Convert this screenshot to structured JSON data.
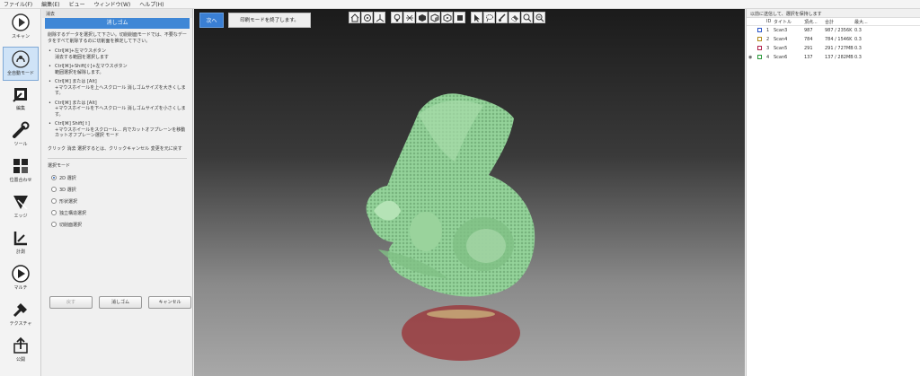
{
  "menu": [
    "ファイル(F)",
    "編集(E)",
    "ビュー",
    "ウィンドウ(W)",
    "ヘルプ(H)"
  ],
  "toolbar": [
    {
      "label": "スキャン",
      "icon": "scan-play-icon"
    },
    {
      "label": "全自動モード",
      "icon": "auto-mode-icon",
      "active": true
    },
    {
      "label": "編集",
      "icon": "edit-icon"
    },
    {
      "label": "ツール",
      "icon": "tools-icon"
    },
    {
      "label": "位置合わせ",
      "icon": "alignment-icon"
    },
    {
      "label": "エッジ",
      "icon": "edge-icon"
    },
    {
      "label": "計測",
      "icon": "measure-icon"
    },
    {
      "label": "マルチ",
      "icon": "multi-icon"
    },
    {
      "label": "テクスチャ",
      "icon": "texture-icon"
    },
    {
      "label": "公開",
      "icon": "publish-icon"
    }
  ],
  "panel": {
    "header": "消去",
    "title": "消しゴム",
    "description": "削除するデータを選択して下さい。切削削面モードでは、不要なデータをすべて削除するのに切削面を推定して下さい。",
    "hints": [
      {
        "key": "Ctrl[⌘]+左マウスボタン",
        "text": "消去する範囲を選択します"
      },
      {
        "key": "Ctrl[⌘]+Shift[⇧]+左マウスボタン",
        "text": "範囲選択を解除します。"
      },
      {
        "key": "Ctrl[⌘] または [Alt]",
        "text": "+マウスホイールを上へスクロール 消しゴムサイズを大きくします。"
      },
      {
        "key": "Ctrl[⌘] または [Alt]",
        "text": "+マウスホイールを下へスクロール 消しゴムサイズを小さくします。"
      },
      {
        "key": "Ctrl[⌘] Shift[⇧]",
        "text": "+マウスホイールをスクロール... 内でカットオフプレーンを移動 カットオフプレーン選択 モード"
      }
    ],
    "footnote": "クリック 消去 選択するとは、クリックキャンセル 変更を元に戻す",
    "mode_title": "選択モード",
    "modes": [
      "2D 選択",
      "3D 選択",
      "形状選択",
      "独立構造選択",
      "切削面選択"
    ],
    "selected_mode": "2D 選択",
    "buttons": {
      "undo": "戻す",
      "erase": "消しゴム",
      "cancel": "キャンセル"
    }
  },
  "viewport": {
    "next_button": "次へ",
    "finish_button": "印刷モードを終了します。",
    "view_tools": [
      "home-view-icon",
      "fit-view-icon",
      "axes-icon",
      "light-bulb-icon",
      "wireframe-icon",
      "cube-solid-icon",
      "cube-shaded-icon",
      "cube-points-icon",
      "pointer-select-icon",
      "lasso-select-icon",
      "brush-select-icon",
      "eraser-icon",
      "zoom-in-icon",
      "zoom-out-icon"
    ]
  },
  "list": {
    "header": "以前に送信して、選択を保持します",
    "columns": [
      "",
      "ID",
      "タイトル",
      "頂点...",
      "合計",
      "最大..."
    ],
    "rows": [
      {
        "id": "1",
        "title": "Scan3",
        "verts": "987",
        "total": "987 / 2356K",
        "max": "0.3",
        "color": "#2a55c8",
        "eye": ""
      },
      {
        "id": "2",
        "title": "Scan4",
        "verts": "784",
        "total": "784 / 1546K",
        "max": "0.3",
        "color": "#b08a1a",
        "eye": ""
      },
      {
        "id": "3",
        "title": "Scan5",
        "verts": "291",
        "total": "291 / 727MB",
        "max": "0.3",
        "color": "#b0204a",
        "eye": ""
      },
      {
        "id": "4",
        "title": "Scan6",
        "verts": "137",
        "total": "137 / 282MB",
        "max": "0.3",
        "color": "#2a9a3a",
        "eye": "◉"
      }
    ]
  }
}
